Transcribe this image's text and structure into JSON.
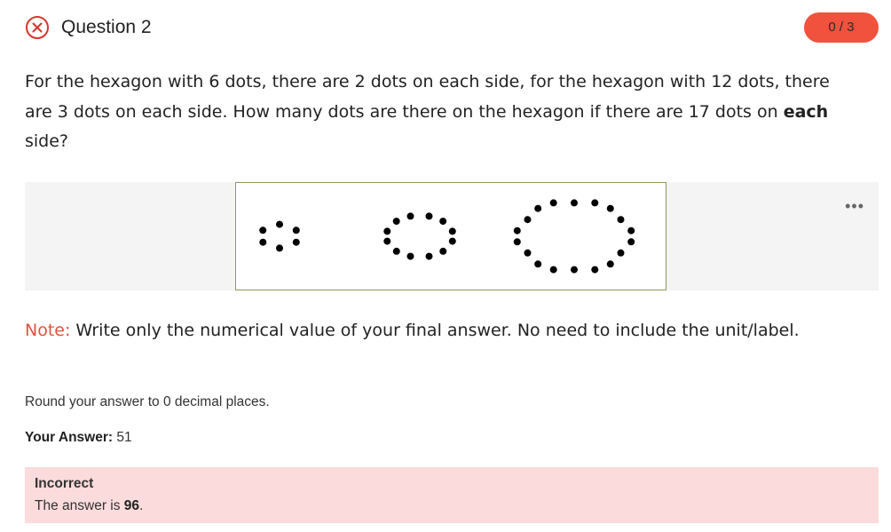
{
  "header": {
    "status_icon": "x-circle-icon",
    "title": "Question 2",
    "score": "0 / 3"
  },
  "question": {
    "text_1": "For the hexagon with 6 dots, there are 2 dots on each side, for the hexagon with 12 dots, there are 3 dots on each side. How many dots are there on the hexagon if there are 17 dots on ",
    "text_bold": "each",
    "text_2": " side?"
  },
  "figure": {
    "hexagons": [
      {
        "dots": 6,
        "dots_per_side": 2
      },
      {
        "dots": 12,
        "dots_per_side": 3
      },
      {
        "dots": 18,
        "dots_per_side": 4
      }
    ],
    "more_icon": "more-dots-icon",
    "more_label": "•••"
  },
  "note": {
    "label": "Note:",
    "text": " Write only the numerical value of your final answer. No need to include the unit/label."
  },
  "round_instruction": "Round your answer to 0 decimal places.",
  "your_answer": {
    "label": "Your Answer:",
    "value": " 51"
  },
  "feedback": {
    "title": "Incorrect",
    "text_prefix": "The answer is ",
    "answer": "96",
    "text_suffix": "."
  },
  "colors": {
    "score_badge": "#f0523d",
    "note_label": "#e0533e",
    "feedback_bg": "#fbdbdb",
    "status_icon": "#d9342b"
  }
}
